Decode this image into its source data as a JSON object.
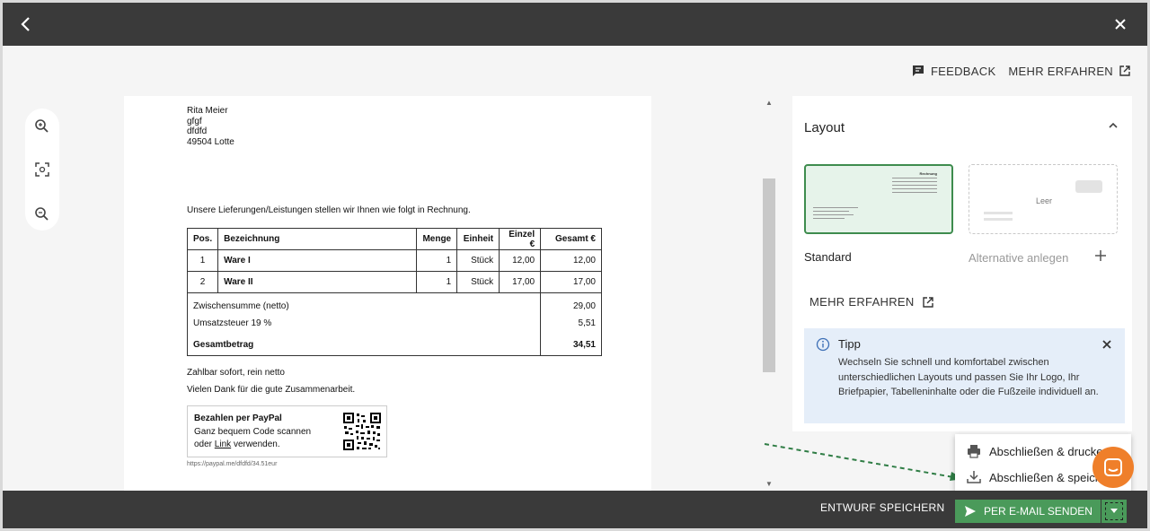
{
  "top_links": {
    "feedback": "FEEDBACK",
    "learn_more": "MEHR ERFAHREN"
  },
  "invoice": {
    "address": [
      "Rita Meier",
      "gfgf",
      "dfdfd",
      "49504 Lotte"
    ],
    "intro": "Unsere Lieferungen/Leistungen stellen wir Ihnen wie folgt in Rechnung.",
    "columns": [
      "Pos.",
      "Bezeichnung",
      "Menge",
      "Einheit",
      "Einzel €",
      "Gesamt €"
    ],
    "rows": [
      [
        "1",
        "Ware I",
        "1",
        "Stück",
        "12,00",
        "12,00"
      ],
      [
        "2",
        "Ware II",
        "1",
        "Stück",
        "17,00",
        "17,00"
      ]
    ],
    "subtotal_label": "Zwischensumme (netto)",
    "subtotal_value": "29,00",
    "tax_label": "Umsatzsteuer 19 %",
    "tax_value": "5,51",
    "total_label": "Gesamtbetrag",
    "total_value": "34,51",
    "payment_terms": "Zahlbar sofort, rein netto",
    "thanks": "Vielen Dank für die gute Zusammenarbeit.",
    "paypal_title": "Bezahlen per PayPal",
    "paypal_line1": "Ganz bequem Code scannen",
    "paypal_line2_pre": "oder",
    "paypal_link": "Link",
    "paypal_line2_post": "verwenden.",
    "paypal_url": "https://paypal.me/dfdfd/34.51eur"
  },
  "layout_panel": {
    "title": "Layout",
    "standard_label": "Standard",
    "thumb_heading": "Rechnung",
    "empty_label": "Leer",
    "alternative_label": "Alternative anlegen",
    "learn_more": "MEHR ERFAHREN",
    "tip_title": "Tipp",
    "tip_text": "Wechseln Sie schnell und komfortabel zwischen unterschiedlichen Layouts und passen Sie Ihr Logo, Ihr Briefpapier, Tabelleninhalte oder die Fußzeile individuell an."
  },
  "dropdown_menu": {
    "print": "Abschließen & drucken",
    "save": "Abschließen & speichern"
  },
  "bottom_bar": {
    "draft": "ENTWURF SPEICHERN",
    "send_email": "PER E-MAIL SENDEN"
  },
  "colors": {
    "accent_green": "#4a9a5a",
    "dark_bar": "#3a3a3a",
    "tip_bg": "#e5eef9",
    "chat_orange": "#ef7f2a",
    "tip_icon": "#3d6fb6"
  }
}
